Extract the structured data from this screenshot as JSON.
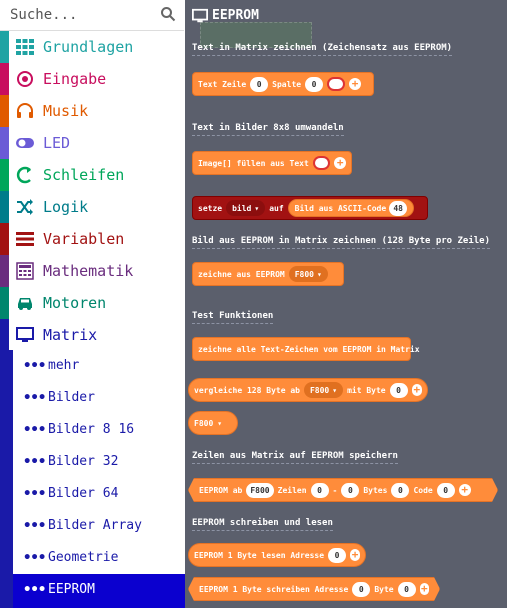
{
  "search": {
    "placeholder": "Suche..."
  },
  "categories": [
    {
      "label": "Grundlagen",
      "color": "#1fa3a3"
    },
    {
      "label": "Eingabe",
      "color": "#c80e5e"
    },
    {
      "label": "Musik",
      "color": "#e05a00"
    },
    {
      "label": "LED",
      "color": "#6b5bd6"
    },
    {
      "label": "Schleifen",
      "color": "#00a65a"
    },
    {
      "label": "Logik",
      "color": "#007c8a"
    },
    {
      "label": "Variablen",
      "color": "#a21212"
    },
    {
      "label": "Mathematik",
      "color": "#6a2d7e"
    },
    {
      "label": "Motoren",
      "color": "#00866d"
    },
    {
      "label": "Matrix",
      "color": "#1a1aa8"
    }
  ],
  "matrix_sub": [
    {
      "label": "mehr"
    },
    {
      "label": "Bilder"
    },
    {
      "label": "Bilder 8 16"
    },
    {
      "label": "Bilder 32"
    },
    {
      "label": "Bilder 64"
    },
    {
      "label": "Bilder Array"
    },
    {
      "label": "Geometrie"
    },
    {
      "label": "EEPROM"
    }
  ],
  "workspace": {
    "title": "EEPROM",
    "headers": [
      "Text in Matrix zeichnen (Zeichensatz aus EEPROM)",
      "Text in Bilder 8x8 umwandeln",
      "Bild aus EEPROM in Matrix zeichnen (128 Byte pro Zeile)",
      "Test Funktionen",
      "Zeilen aus Matrix auf EEPROM speichern",
      "EEPROM schreiben und lesen"
    ],
    "blocks": {
      "text_zeile": {
        "a": "Text Zeile",
        "v1": "0",
        "b": "Spalte",
        "v2": "0"
      },
      "image_fill": {
        "a": "Image[] füllen aus Text"
      },
      "setze": {
        "a": "setze",
        "var": "bild",
        "b": "auf",
        "c": "Bild aus ASCII-Code",
        "v": "48"
      },
      "zeichne": {
        "a": "zeichne aus EEPROM",
        "dd": "F800"
      },
      "alle_zeichen": {
        "a": "zeichne alle Text-Zeichen vom EEPROM in Matrix"
      },
      "vergleiche": {
        "a": "vergleiche 128 Byte ab",
        "dd": "F800",
        "b": "mit Byte",
        "v": "0"
      },
      "f800": {
        "dd": "F800"
      },
      "eeprom_ab": {
        "a": "EEPROM ab",
        "s": "F800",
        "b": "Zeilen",
        "v1": "0",
        "c": "-",
        "v2": "0",
        "d": "Bytes",
        "v3": "0",
        "e": "Code",
        "v4": "0"
      },
      "lesen": {
        "a": "EEPROM 1 Byte lesen Adresse",
        "v": "0"
      },
      "schreiben": {
        "a": "EEPROM 1 Byte schreiben Adresse",
        "v1": "0",
        "b": "Byte",
        "v2": "0"
      }
    }
  }
}
